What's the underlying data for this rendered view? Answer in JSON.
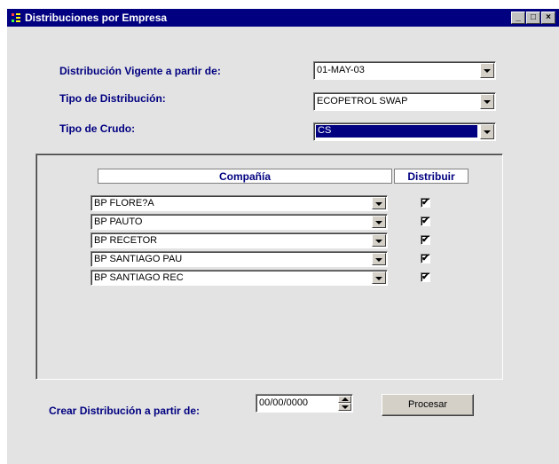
{
  "window": {
    "title": "Distribuciones por Empresa"
  },
  "form": {
    "distribucion_label": "Distribución Vigente a partir de:",
    "distribucion_value": "01-MAY-03",
    "tipo_distribucion_label": "Tipo de Distribución:",
    "tipo_distribucion_value": "ECOPETROL SWAP",
    "tipo_crudo_label": "Tipo de Crudo:",
    "tipo_crudo_value": "CS"
  },
  "table": {
    "col_compania": "Compañía",
    "col_distribuir": "Distribuir",
    "rows": [
      {
        "compania": "BP FLORE?A",
        "distribuir": true
      },
      {
        "compania": "BP PAUTO",
        "distribuir": true
      },
      {
        "compania": "BP RECETOR",
        "distribuir": true
      },
      {
        "compania": "BP SANTIAGO PAU",
        "distribuir": true
      },
      {
        "compania": "BP SANTIAGO REC",
        "distribuir": true
      }
    ]
  },
  "footer": {
    "crear_label": "Crear Distribución a partir de:",
    "crear_value": "00/00/0000",
    "procesar_label": "Procesar"
  },
  "icons": {
    "check": "✔",
    "minimize": "_",
    "maximize": "□",
    "close": "×"
  },
  "colors": {
    "title_bar": "#000080",
    "label": "#000080"
  }
}
